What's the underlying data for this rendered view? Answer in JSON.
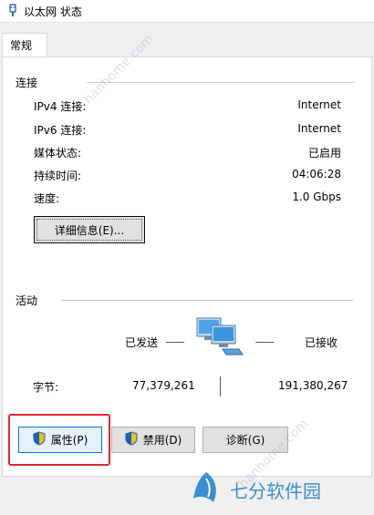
{
  "window": {
    "title": "以太网 状态"
  },
  "tabs": [
    {
      "label": "常规"
    }
  ],
  "connection": {
    "header": "连接",
    "rows": [
      {
        "label": "IPv4 连接:",
        "value": "Internet"
      },
      {
        "label": "IPv6 连接:",
        "value": "Internet"
      },
      {
        "label": "媒体状态:",
        "value": "已启用"
      },
      {
        "label": "持续时间:",
        "value": "04:06:28"
      },
      {
        "label": "速度:",
        "value": "1.0 Gbps"
      }
    ],
    "details_button": "详细信息(E)..."
  },
  "activity": {
    "header": "活动",
    "sent_label": "已发送",
    "received_label": "已接收",
    "bytes_label": "字节:",
    "bytes_sent": "77,379,261",
    "bytes_received": "191,380,267"
  },
  "buttons": {
    "properties": "属性(P)",
    "disable": "禁用(D)",
    "diagnose": "诊断(G)"
  },
  "watermark": {
    "text": "七分软件园",
    "diagonal": "hanhome.com"
  },
  "colors": {
    "highlight": "#e0282e",
    "accent": "#0078d7",
    "watermark": "#3a8fd0"
  }
}
